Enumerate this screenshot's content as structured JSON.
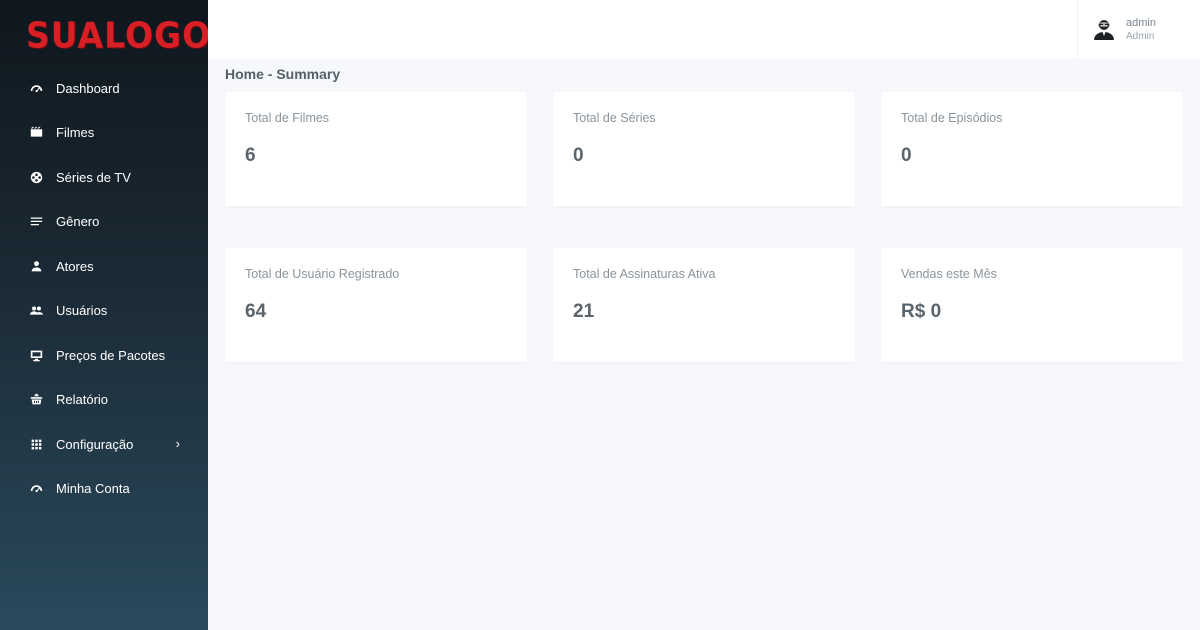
{
  "brand": {
    "logo_text": "SUALOGO",
    "logo_color": "#d81f26"
  },
  "sidebar": {
    "items": [
      {
        "label": "Dashboard",
        "icon": "speedometer-icon"
      },
      {
        "label": "Filmes",
        "icon": "movie-icon"
      },
      {
        "label": "Séries de TV",
        "icon": "film-reel-icon"
      },
      {
        "label": "Gênero",
        "icon": "list-icon"
      },
      {
        "label": "Atores",
        "icon": "person-icon"
      },
      {
        "label": "Usuários",
        "icon": "users-icon"
      },
      {
        "label": "Preços de Pacotes",
        "icon": "monitor-icon"
      },
      {
        "label": "Relatório",
        "icon": "basket-icon"
      },
      {
        "label": "Configuração",
        "icon": "grid-icon",
        "chevron": "›"
      },
      {
        "label": "Minha Conta",
        "icon": "speedometer-icon"
      }
    ]
  },
  "header": {
    "user": {
      "name": "admin",
      "role": "Admin",
      "icon": "user-avatar-icon"
    }
  },
  "breadcrumb": "Home - Summary",
  "cards": [
    {
      "label": "Total de Filmes",
      "value": "6"
    },
    {
      "label": "Total de Séries",
      "value": "0"
    },
    {
      "label": "Total de Episódios",
      "value": "0"
    },
    {
      "label": "Total de Usuário Registrado",
      "value": "64"
    },
    {
      "label": "Total de Assinaturas Ativa",
      "value": "21"
    },
    {
      "label": "Vendas este Mês",
      "value": "R$ 0"
    }
  ]
}
